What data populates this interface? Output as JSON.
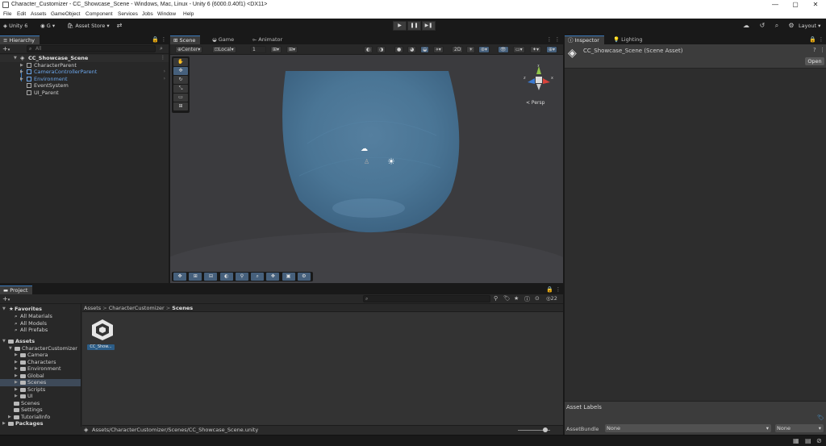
{
  "window": {
    "title": "Character_Customizer - CC_Showcase_Scene - Windows, Mac, Linux - Unity 6 (6000.0.40f1) <DX11>",
    "minimize": "—",
    "maximize": "▢",
    "close": "✕"
  },
  "menu": [
    "File",
    "Edit",
    "Assets",
    "GameObject",
    "Component",
    "Services",
    "Jobs",
    "Window",
    "Help"
  ],
  "toolbar": {
    "unity_label": "Unity 6",
    "account_label": "G",
    "asset_store_label": "Asset Store",
    "play": "▶",
    "pause": "❚❚",
    "step": "▶❚",
    "layout_label": "Layout"
  },
  "hierarchy": {
    "tab_label": "Hierarchy",
    "search_placeholder": "All",
    "scene_name": "CC_Showcase_Scene",
    "items": [
      {
        "label": "CharacterParent",
        "blue": false
      },
      {
        "label": "CameraControllerParent",
        "blue": true
      },
      {
        "label": "Environment",
        "blue": true
      },
      {
        "label": "EventSystem",
        "blue": false
      },
      {
        "label": "UI_Parent",
        "blue": false
      }
    ]
  },
  "scene": {
    "tabs": [
      "Scene",
      "Game",
      "Animator"
    ],
    "pivot_label": "Center",
    "space_label": "Local",
    "grid_value": "1",
    "twod_label": "2D",
    "persp_label": "< Persp",
    "gizmo_axes": {
      "y": "y",
      "x": "x",
      "z": "z"
    }
  },
  "inspector": {
    "tabs": [
      "Inspector",
      "Lighting"
    ],
    "asset_title": "CC_Showcase_Scene (Scene Asset)",
    "open_button": "Open",
    "asset_labels_title": "Asset Labels",
    "assetbundle_label": "AssetBundle",
    "assetbundle_value": "None",
    "variant_value": "None"
  },
  "project": {
    "tab_label": "Project",
    "item_count": "22",
    "favorites_label": "Favorites",
    "favorites": [
      "All Materials",
      "All Models",
      "All Prefabs"
    ],
    "assets_label": "Assets",
    "character_customizer_label": "CharacterCustomizer",
    "subfolders": [
      "Camera",
      "Characters",
      "Environment",
      "Global",
      "Scenes",
      "Scripts",
      "UI"
    ],
    "root_folders": [
      "Scenes",
      "Settings",
      "TutorialInfo"
    ],
    "packages_label": "Packages",
    "breadcrumb": [
      "Assets",
      "CharacterCustomizer",
      "Scenes"
    ],
    "breadcrumb_sep": ">",
    "asset_name": "CC_Show...",
    "status_path": "Assets/CharacterCustomizer/Scenes/CC_Showcase_Scene.unity"
  },
  "colors": {
    "accent_blue": "#3a79bb",
    "prefab_blue": "#6ca6ea",
    "skybox": "#4a7595"
  }
}
